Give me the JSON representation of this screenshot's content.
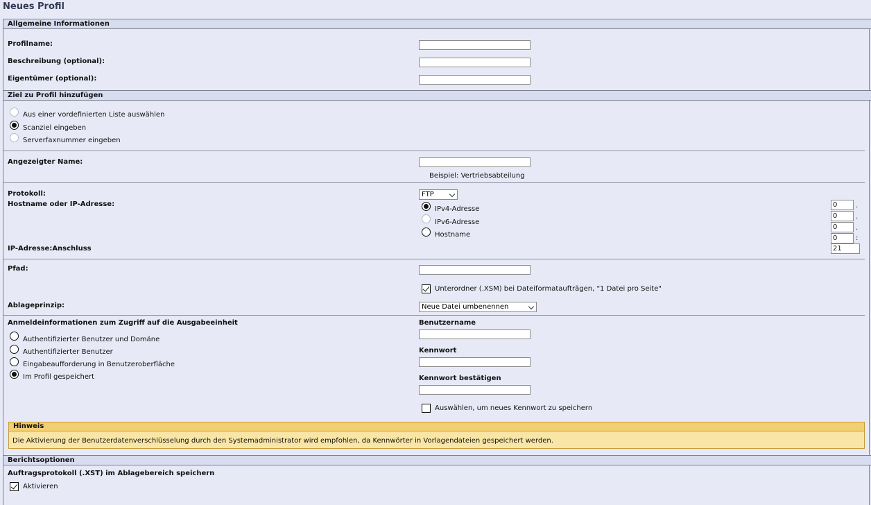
{
  "page_title": "Neues Profil",
  "general": {
    "header": "Allgemeine Informationen",
    "profile_name_label": "Profilname:",
    "profile_name_value": "",
    "description_label": "Beschreibung (optional):",
    "description_value": "",
    "owner_label": "Eigentümer (optional):",
    "owner_value": ""
  },
  "target": {
    "header": "Ziel zu Profil hinzufügen",
    "options": [
      {
        "label": "Aus einer vordefinierten Liste auswählen",
        "selected": false
      },
      {
        "label": "Scanziel eingeben",
        "selected": true
      },
      {
        "label": "Serverfaxnummer eingeben",
        "selected": false
      }
    ],
    "display_name_label": "Angezeigter Name:",
    "display_name_value": "",
    "display_name_example": "Beispiel: Vertriebsabteilung",
    "protocol_label": "Protokoll:",
    "protocol_value": "FTP",
    "host_label": "Hostname oder IP-Adresse:",
    "address_types": [
      {
        "label": "IPv4-Adresse",
        "selected": true
      },
      {
        "label": "IPv6-Adresse",
        "selected": false
      },
      {
        "label": "Hostname",
        "selected": false
      }
    ],
    "ip_octets": [
      "0",
      "0",
      "0",
      "0"
    ],
    "ip_separators": [
      ".",
      ".",
      ".",
      ":"
    ],
    "port_label": "IP-Adresse:Anschluss",
    "port_value": "21",
    "path_label": "Pfad:",
    "path_value": "",
    "subfolder_label": "Unterordner (.XSM) bei Dateiformataufträgen, \"1 Datei pro Seite\"",
    "subfolder_checked": true,
    "filing_label": "Ablageprinzip:",
    "filing_value": "Neue Datei umbenennen",
    "credentials_label": "Anmeldeinformationen zum Zugriff auf die Ausgabeeinheit",
    "credential_options": [
      {
        "label": "Authentifizierter Benutzer und Domäne",
        "selected": false
      },
      {
        "label": "Authentifizierter Benutzer",
        "selected": false
      },
      {
        "label": "Eingabeaufforderung in Benutzeroberfläche",
        "selected": false
      },
      {
        "label": "Im Profil gespeichert",
        "selected": true
      }
    ],
    "username_label": "Benutzername",
    "username_value": "",
    "password_label": "Kennwort",
    "password_value": "",
    "confirm_password_label": "Kennwort bestätigen",
    "confirm_password_value": "",
    "save_password_label": "Auswählen, um neues Kennwort zu speichern",
    "save_password_checked": false
  },
  "hint": {
    "title": "Hinweis",
    "text": "Die Aktivierung der Benutzerdatenverschlüsselung durch den Systemadministrator wird empfohlen, da Kennwörter in Vorlagendateien gespeichert werden."
  },
  "report": {
    "header": "Berichtsoptionen",
    "job_log_label": "Auftragsprotokoll (.XST) im Ablagebereich speichern",
    "enable_label": "Aktivieren",
    "enable_checked": true
  }
}
